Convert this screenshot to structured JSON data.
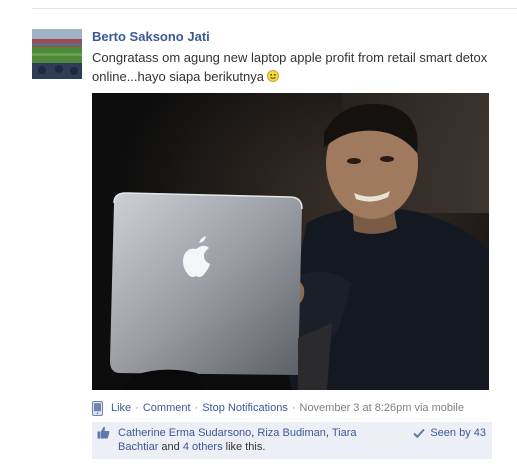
{
  "post": {
    "author": "Berto Saksono Jati",
    "message": "Congratass om agung new laptop apple profit from retail smart detox online...hayo siapa berikutnya",
    "photo_alt": "Photo",
    "smiley_icon": "smiley-icon",
    "avatar_icon": "stadium-avatar"
  },
  "actions": {
    "like": "Like",
    "comment": "Comment",
    "stop_notifications": "Stop Notifications",
    "separator": "·",
    "timestamp": "November 3 at 8:26pm via mobile",
    "mobile_icon": "mobile-phone-icon"
  },
  "likes": {
    "likers": [
      "Catherine Erma Sudarsono",
      "Riza Budiman",
      "Tiara Bachtiar"
    ],
    "comma": ",",
    "and_text": "and",
    "others_link": "4 others",
    "like_suffix": "like this.",
    "seen_label": "Seen by 43",
    "thumb_icon": "thumbs-up-icon",
    "check_icon": "check-icon"
  },
  "colors": {
    "link": "#3b5998",
    "muted": "#808080",
    "likes_bg": "#eceff5"
  }
}
